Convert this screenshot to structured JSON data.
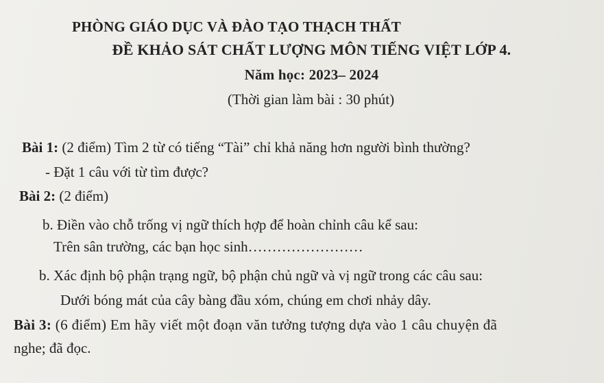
{
  "header": {
    "department": "PHÒNG GIÁO DỤC VÀ ĐÀO TẠO THẠCH THẤT",
    "exam_title": "ĐỀ KHẢO SÁT CHẤT LƯỢNG MÔN TIẾNG VIỆT LỚP 4.",
    "school_year": "Năm học: 2023– 2024",
    "duration": "(Thời gian làm bài : 30 phút)"
  },
  "questions": {
    "q1": {
      "label": "Bài 1:",
      "text": " (2 điểm) Tìm 2 từ có tiếng “Tài” chỉ khả năng hơn người bình thường?",
      "sub": "-   Đặt 1 câu với từ tìm được?"
    },
    "q2": {
      "label": "Bài 2:",
      "text": " (2 điểm)",
      "part_a": "b.  Điền vào chỗ trống vị ngữ thích hợp để hoàn chỉnh câu kể sau:",
      "part_a_sentence": "Trên sân trường, các bạn học sinh……………………",
      "part_b": "b. Xác định bộ phận trạng ngữ, bộ phận chủ ngữ và vị ngữ trong các câu sau:",
      "part_b_sentence": "Dưới bóng mát của cây bàng đầu xóm, chúng em chơi nhảy dây."
    },
    "q3": {
      "label": "Bài 3:",
      "text_line1": " (6 điểm) Em hãy viết một đoạn văn tưởng tượng dựa vào 1 câu chuyện đã",
      "text_line2": "nghe; đã đọc."
    }
  }
}
